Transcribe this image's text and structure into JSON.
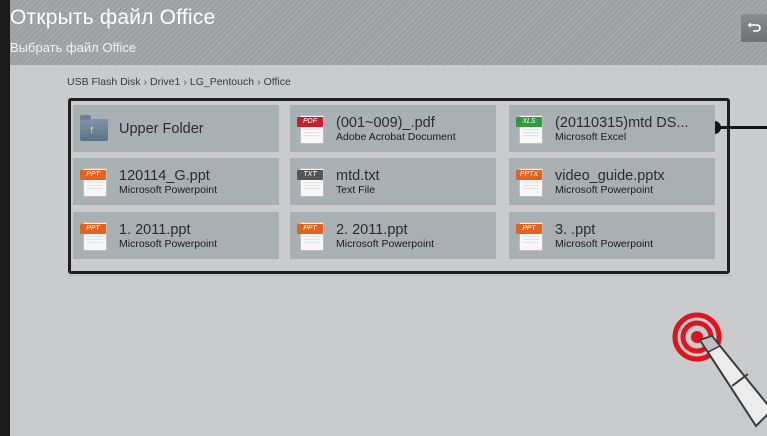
{
  "header": {
    "title": "Открыть файл Office",
    "subtitle": "Выбрать файл Office",
    "back_icon": "return-arrow-icon"
  },
  "breadcrumb": [
    "USB Flash Disk",
    "Drive1",
    "LG_Pentouch",
    "Office"
  ],
  "files": [
    {
      "name": "Upper Folder",
      "type": "",
      "icon": "folder-up-icon"
    },
    {
      "name": "(001~009)_.pdf",
      "type": "Adobe Acrobat Document",
      "icon": "pdf-file-icon",
      "tag": "PDF",
      "tag_color": "#c8202a"
    },
    {
      "name": "(20110315)mtd DS...",
      "type": "Microsoft Excel",
      "icon": "xls-file-icon",
      "tag": "XLS",
      "tag_color": "#2e9a3e"
    },
    {
      "name": "120114_G.ppt",
      "type": "Microsoft Powerpoint",
      "icon": "ppt-file-icon",
      "tag": "PPT",
      "tag_color": "#e2621f"
    },
    {
      "name": "mtd.txt",
      "type": "Text File",
      "icon": "txt-file-icon",
      "tag": "TXT",
      "tag_color": "#555555"
    },
    {
      "name": "video_guide.pptx",
      "type": "Microsoft Powerpoint",
      "icon": "pptx-file-icon",
      "tag": "PPTX",
      "tag_color": "#e2621f"
    },
    {
      "name": "1. 2011.ppt",
      "type": "Microsoft Powerpoint",
      "icon": "ppt-file-icon",
      "tag": "PPT",
      "tag_color": "#e2621f"
    },
    {
      "name": "2. 2011.ppt",
      "type": "Microsoft Powerpoint",
      "icon": "ppt-file-icon",
      "tag": "PPT",
      "tag_color": "#e2621f"
    },
    {
      "name": "3. .ppt",
      "type": "Microsoft Powerpoint",
      "icon": "ppt-file-icon",
      "tag": "PPT",
      "tag_color": "#e2621f"
    }
  ],
  "colors": {
    "accent_red": "#e0141e",
    "tile_bg": "#a9b0b3",
    "screen_bg": "#c9cbcd"
  }
}
